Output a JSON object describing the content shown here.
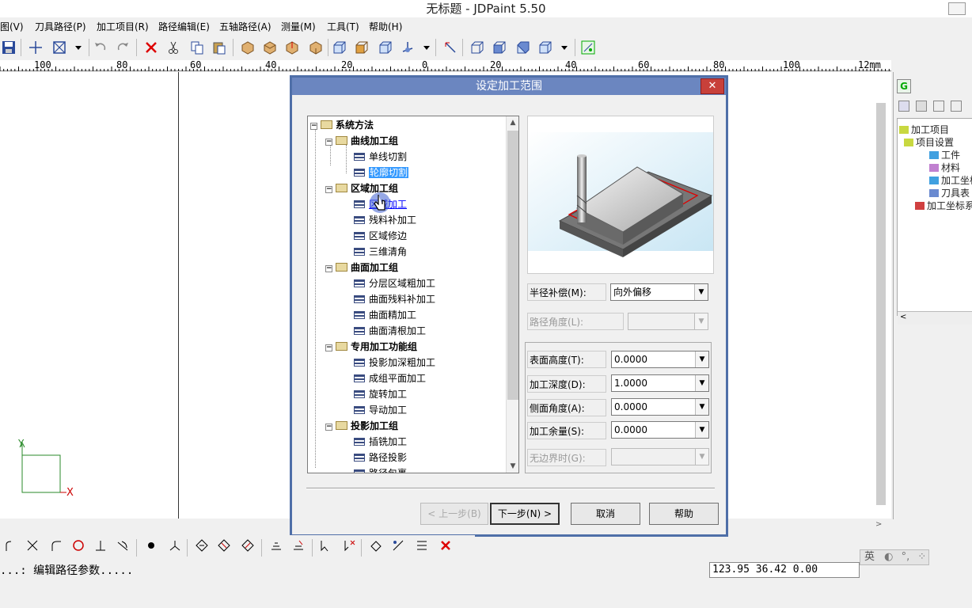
{
  "window": {
    "title": "无标题 - JDPaint 5.50"
  },
  "menu": [
    "视图(V)",
    "刀具路径(P)",
    "加工项目(R)",
    "路径编辑(E)",
    "五轴路径(A)",
    "测量(M)",
    "工具(T)",
    "帮助(H)"
  ],
  "menu_visible": [
    "图(V)",
    "刀具路径(P)",
    "加工项目(R)",
    "路径编辑(E)",
    "五轴路径(A)",
    "测量(M)",
    "工具(T)",
    "帮助(H)"
  ],
  "toolbar_icons": [
    "save-icon",
    "crosshair-icon",
    "window-select-icon",
    "undo-icon",
    "redo-icon",
    "delete-icon",
    "cut-icon",
    "copy-icon",
    "paste-icon",
    "box-view-icon"
  ],
  "ruler": {
    "labels": [
      "100",
      "80",
      "60",
      "40",
      "20",
      "0",
      "20",
      "40",
      "60",
      "80",
      "100"
    ],
    "unit": "12mm"
  },
  "dialog": {
    "title": "设定加工范围",
    "close": "✕",
    "tree": {
      "root": "系统方法",
      "items": [
        {
          "label": "曲线加工组",
          "group": true
        },
        {
          "label": "单线切割"
        },
        {
          "label": "轮廓切割",
          "selected": true
        },
        {
          "label": "区域加工组",
          "group": true
        },
        {
          "label": "区域加工",
          "hover": true
        },
        {
          "label": "残料补加工"
        },
        {
          "label": "区域修边"
        },
        {
          "label": "三维清角"
        },
        {
          "label": "曲面加工组",
          "group": true
        },
        {
          "label": "分层区域粗加工"
        },
        {
          "label": "曲面残料补加工"
        },
        {
          "label": "曲面精加工"
        },
        {
          "label": "曲面清根加工"
        },
        {
          "label": "专用加工功能组",
          "group": true
        },
        {
          "label": "投影加深粗加工"
        },
        {
          "label": "成组平面加工"
        },
        {
          "label": "旋转加工"
        },
        {
          "label": "导动加工"
        },
        {
          "label": "投影加工组",
          "group": true
        },
        {
          "label": "插铣加工"
        },
        {
          "label": "路径投影"
        },
        {
          "label": "路径包裹"
        }
      ]
    },
    "fields": {
      "radius_comp": {
        "label": "半径补偿(M):",
        "value": "向外偏移"
      },
      "path_angle": {
        "label": "路径角度(L):",
        "value": ""
      },
      "surface_height": {
        "label": "表面高度(T):",
        "value": "0.0000"
      },
      "depth": {
        "label": "加工深度(D):",
        "value": "1.0000"
      },
      "side_angle": {
        "label": "侧面角度(A):",
        "value": "0.0000"
      },
      "allowance": {
        "label": "加工余量(S):",
        "value": "0.0000"
      },
      "no_boundary": {
        "label": "无边界时(G):",
        "value": ""
      }
    },
    "buttons": {
      "prev": "< 上一步(B)",
      "next": "下一步(N) >",
      "cancel": "取消",
      "help": "帮助"
    }
  },
  "right_panel": {
    "tab": "G",
    "tree": [
      "加工项目",
      "项目设置",
      "工件",
      "材料",
      "加工坐标",
      "刀具表",
      "加工坐标系"
    ]
  },
  "axis_labels": {
    "y": "Y",
    "x": "X"
  },
  "status": {
    "message": "...: 编辑路径参数.....",
    "coords": "123.95  36.42  0.00"
  },
  "ime": {
    "label": "英"
  }
}
